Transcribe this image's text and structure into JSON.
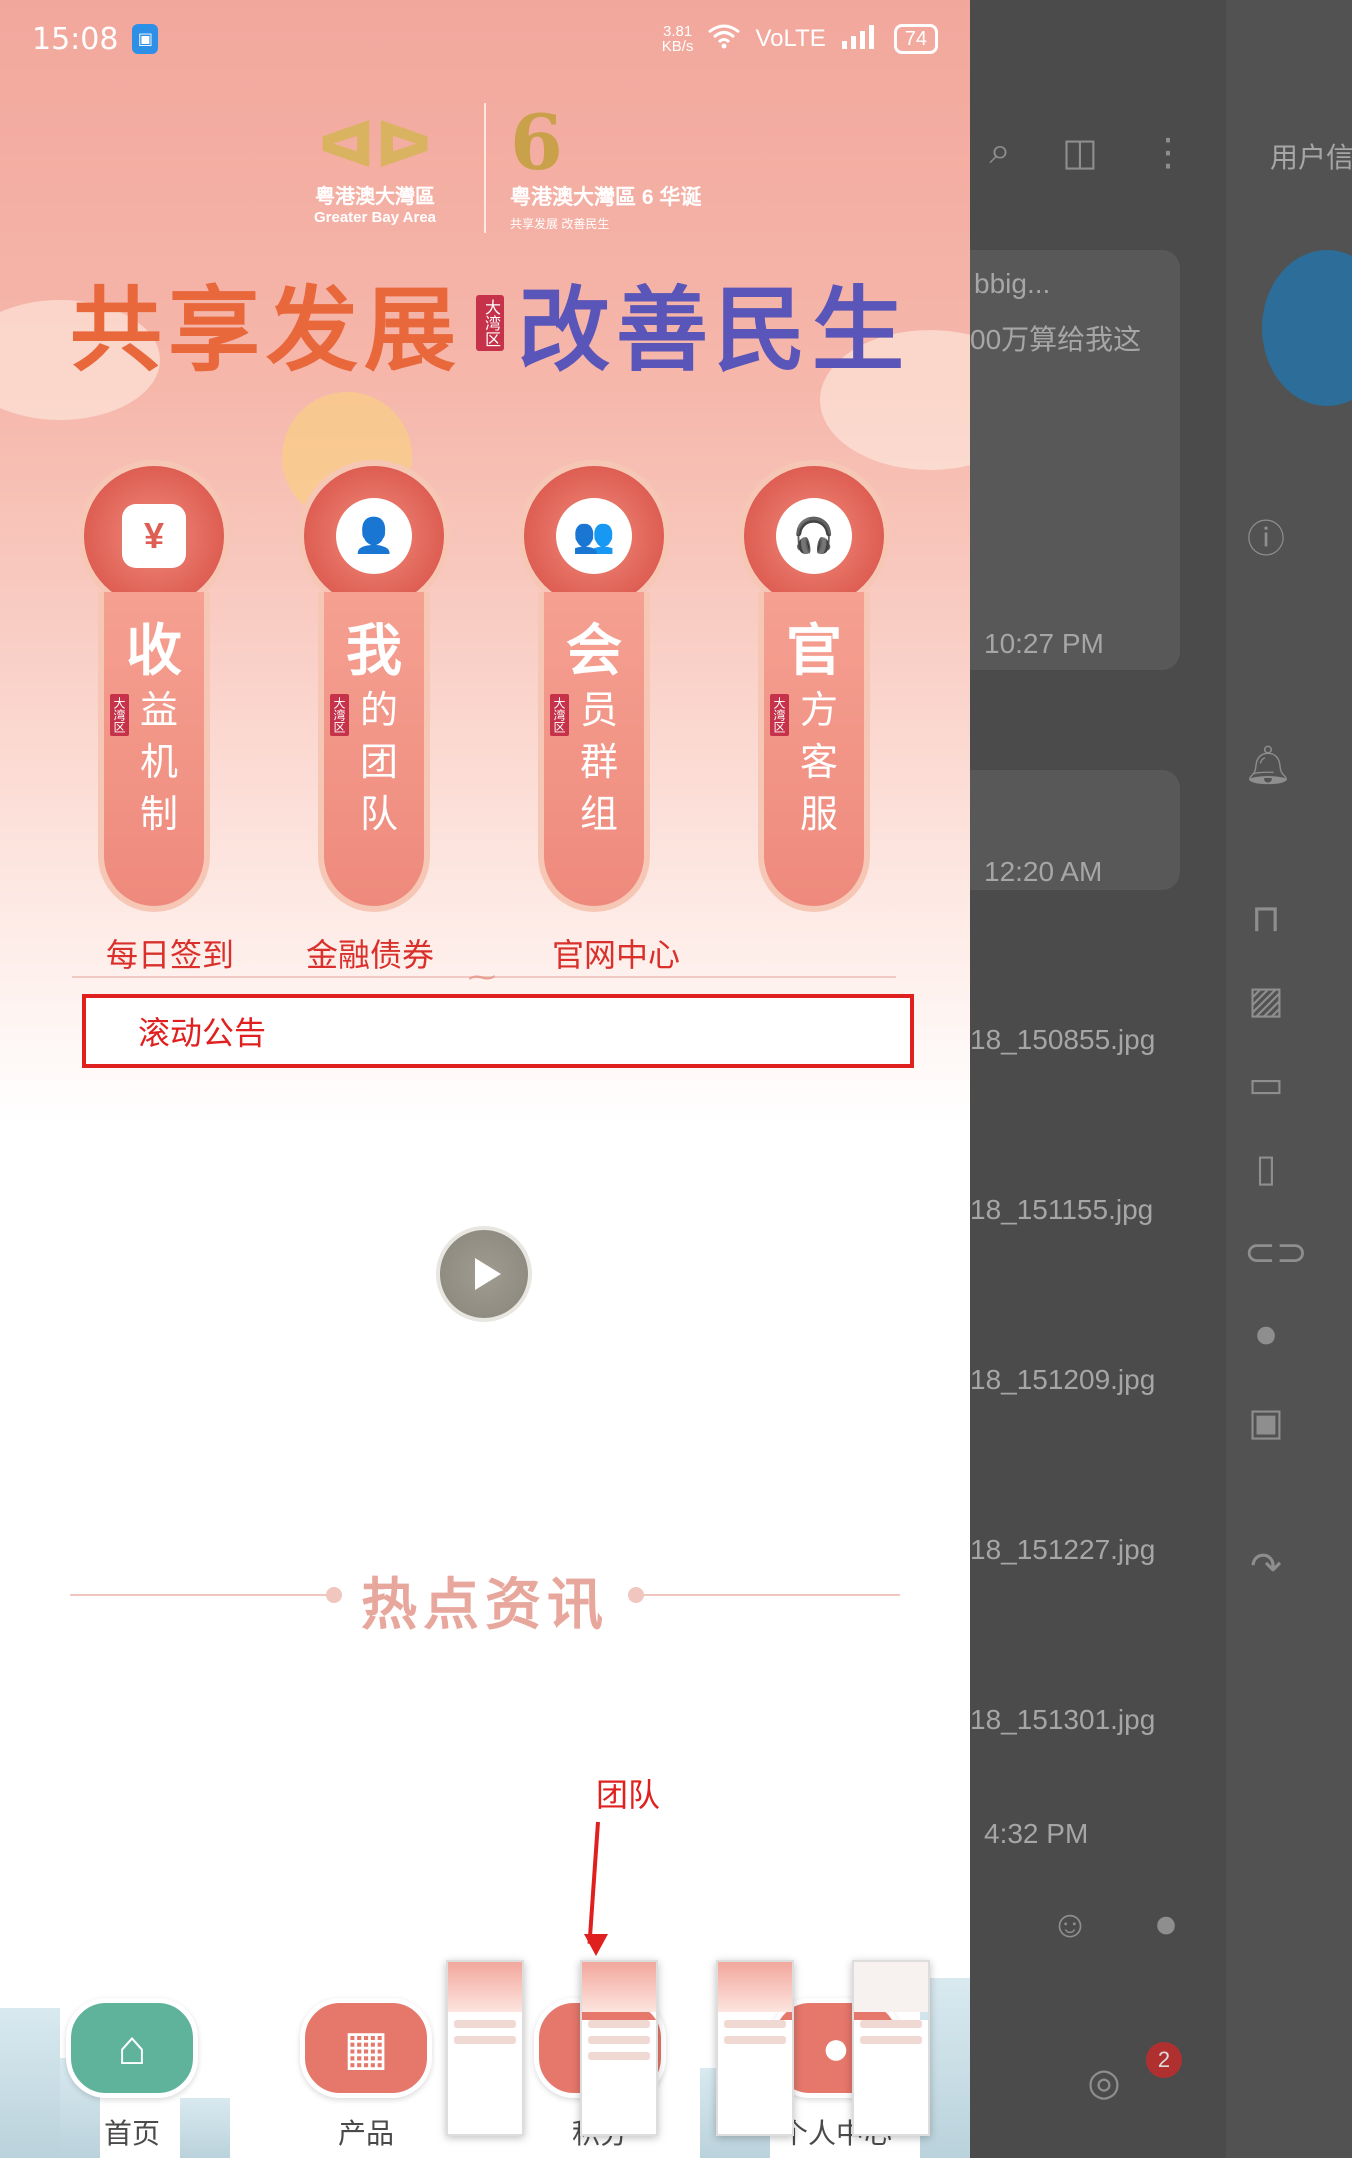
{
  "status_bar": {
    "time": "15:08",
    "speed_value": "3.81",
    "speed_unit": "KB/s",
    "network": "VoLTE",
    "battery": "74"
  },
  "brand": {
    "logo1_line1": "粤港澳大灣區",
    "logo1_line2": "Greater Bay Area",
    "logo2_number": "6",
    "logo2_line1": "粤港澳大灣區 6 华诞",
    "logo2_line2": "共享发展 改善民生"
  },
  "headline": {
    "left": "共享发展",
    "tag": "大湾区",
    "right": "改善民生"
  },
  "tiles": [
    {
      "big": "收",
      "small": "益机制",
      "tag": "大湾区",
      "icon": "wallet-yen-icon",
      "glyph": "¥"
    },
    {
      "big": "我",
      "small": "的团队",
      "tag": "大湾区",
      "icon": "user-icon",
      "glyph": "👤"
    },
    {
      "big": "会",
      "small": "员群组",
      "tag": "大湾区",
      "icon": "group-icon",
      "glyph": "👥"
    },
    {
      "big": "官",
      "small": "方客服",
      "tag": "大湾区",
      "icon": "headset-icon",
      "glyph": "🎧"
    }
  ],
  "quicklinks": {
    "checkin": "每日签到",
    "bonds": "金融债券",
    "official": "官网中心"
  },
  "notice": {
    "label": "滚动公告"
  },
  "hot_news": {
    "title": "热点资讯"
  },
  "annotation": {
    "label": "团队"
  },
  "tabbar": [
    {
      "label": "首页",
      "icon": "home-icon",
      "color": "#5fb39b"
    },
    {
      "label": "产品",
      "icon": "grid-icon",
      "color": "#e5776b"
    },
    {
      "label": "积分",
      "icon": "points-icon",
      "color": "#e5776b"
    },
    {
      "label": "个人中心",
      "icon": "person-icon",
      "color": "#e5776b"
    }
  ],
  "side_panel": {
    "header_text": "用户信",
    "preview_line1": "bbig...",
    "preview_line2": "00万算给我这",
    "times": [
      "10:27 PM",
      "12:20 AM",
      "4:32 PM"
    ],
    "files": [
      "18_150855.jpg",
      "18_151155.jpg",
      "18_151209.jpg",
      "18_151227.jpg",
      "18_151301.jpg"
    ],
    "badge": "2"
  }
}
